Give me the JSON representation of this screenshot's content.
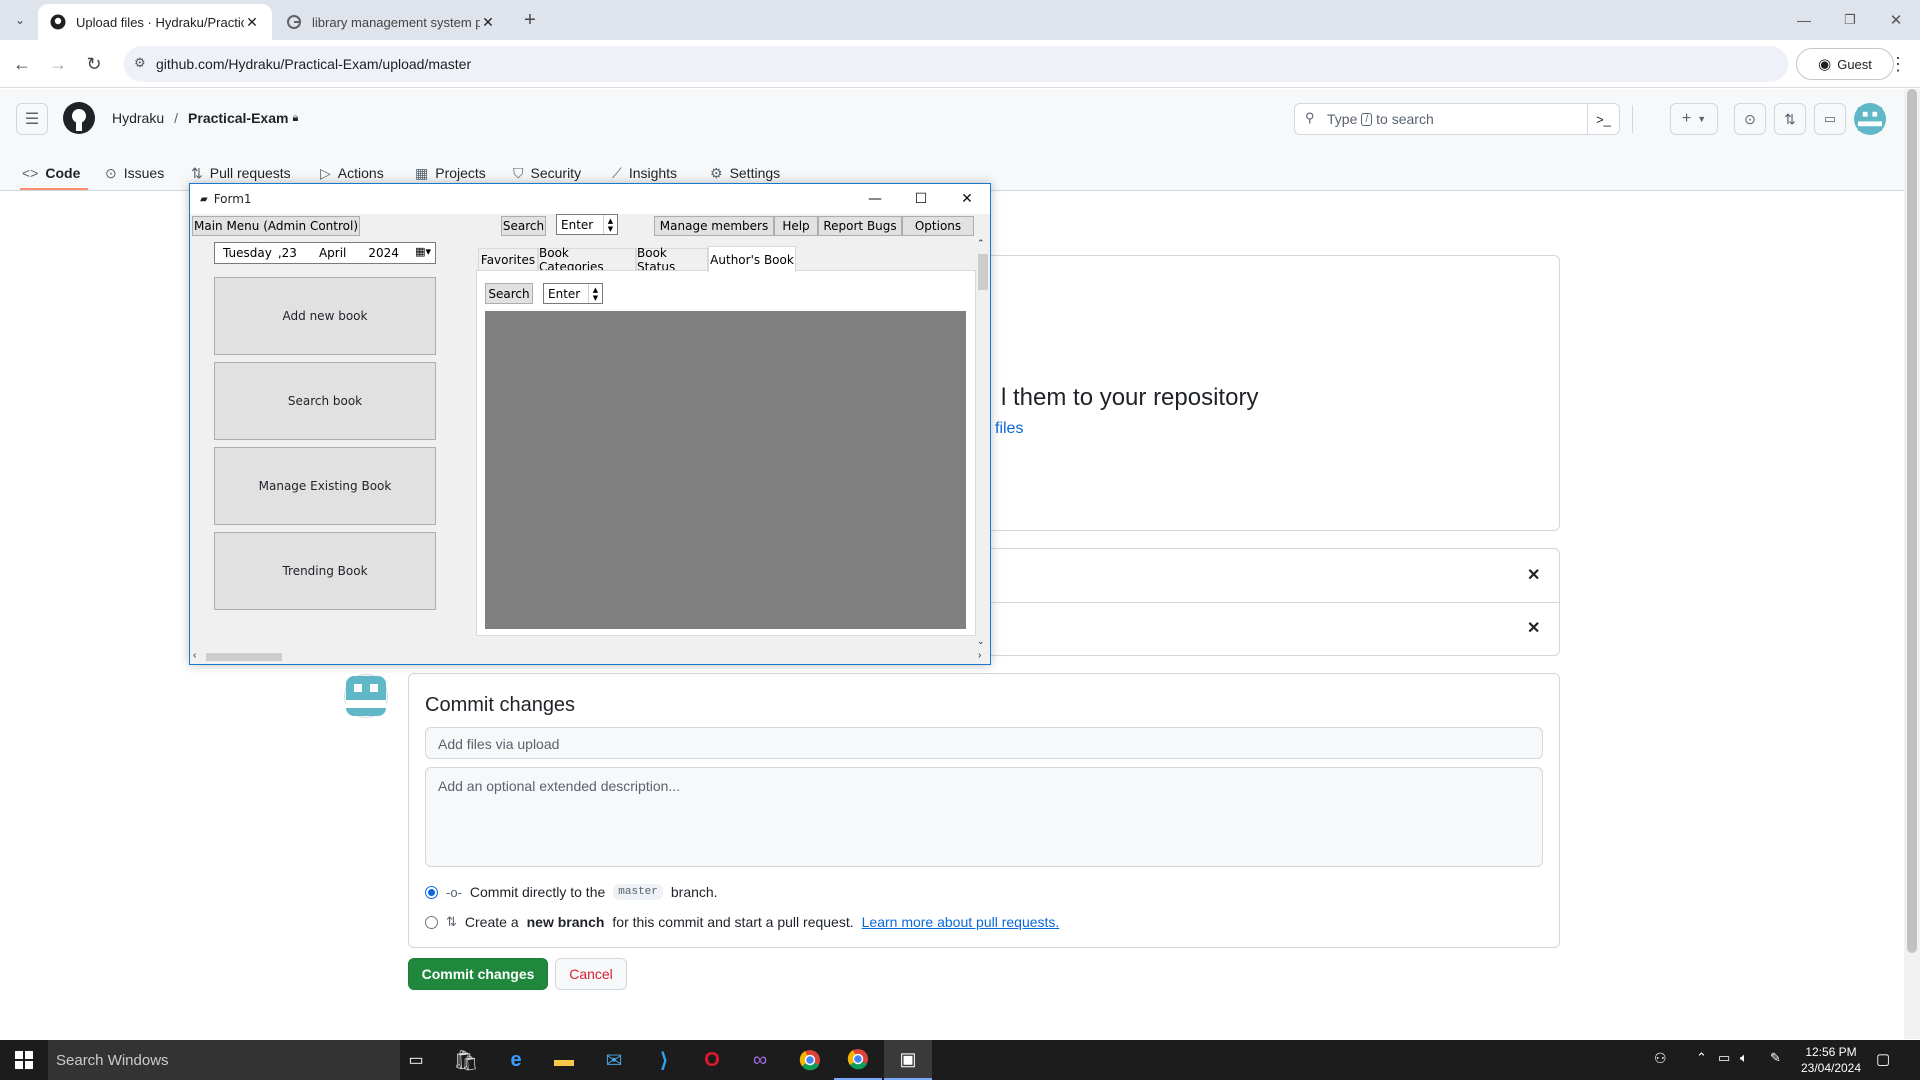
{
  "browser": {
    "tabs": [
      {
        "title": "Upload files · Hydraku/Practical-Exam",
        "active": true
      },
      {
        "title": "library management system project",
        "active": false
      }
    ],
    "url": "github.com/Hydraku/Practical-Exam/upload/master",
    "profile_label": "Guest"
  },
  "github": {
    "owner": "Hydraku",
    "separator": "/",
    "repo": "Practical-Exam",
    "search_prefix": "Type",
    "search_key": "/",
    "search_suffix": "to search",
    "nav": [
      {
        "label": "Code",
        "icon": "code-icon"
      },
      {
        "label": "Issues",
        "icon": "issue-icon"
      },
      {
        "label": "Pull requests",
        "icon": "pull-request-icon"
      },
      {
        "label": "Actions",
        "icon": "play-icon"
      },
      {
        "label": "Projects",
        "icon": "table-icon"
      },
      {
        "label": "Security",
        "icon": "shield-icon"
      },
      {
        "label": "Insights",
        "icon": "graph-icon"
      },
      {
        "label": "Settings",
        "icon": "gear-icon"
      }
    ],
    "upload_heading_partial": "l them to your repository",
    "upload_link_partial": "files",
    "commit": {
      "heading": "Commit changes",
      "summary_placeholder": "Add files via upload",
      "description_placeholder": "Add an optional extended description...",
      "option1_pre": "Commit directly to the",
      "branch": "master",
      "option1_post": "branch.",
      "option2_pre": "Create a",
      "option2_bold": "new branch",
      "option2_mid": "for this commit and start a pull request.",
      "option2_link": "Learn more about pull requests.",
      "submit": "Commit changes",
      "cancel": "Cancel"
    },
    "accent": "#1f883d",
    "link_color": "#0969da"
  },
  "form1": {
    "title": "Form1",
    "menu": {
      "main": "Main Menu (Admin Control)",
      "search_btn": "Search",
      "search_value": "Enter",
      "items": [
        "Manage members",
        "Help",
        "Report Bugs",
        "Options"
      ]
    },
    "date": {
      "weekday": "Tuesday",
      "sep": ",",
      "day": "23",
      "month": "April",
      "year": "2024"
    },
    "buttons": [
      "Add new book",
      "Search book",
      "Manage Existing Book",
      "Trending Book"
    ],
    "tabs": [
      "Favorites",
      "Book Categories",
      "Book Status",
      "Author's Book"
    ],
    "active_tab": "Author's Book",
    "tab_search_btn": "Search",
    "tab_search_value": "Enter"
  },
  "taskbar": {
    "search_placeholder": "Search Windows",
    "time": "12:56 PM",
    "date": "23/04/2024"
  }
}
